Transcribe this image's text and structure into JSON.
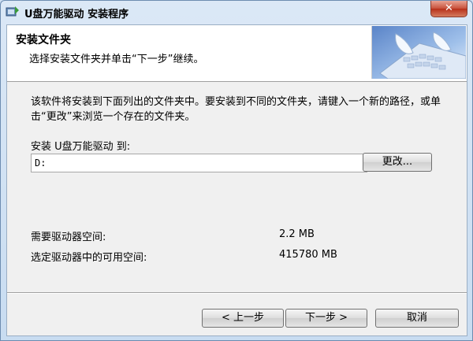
{
  "window": {
    "title": "U盘万能驱动 安装程序",
    "close_label": "✕",
    "app_icon": "installer-icon",
    "accent": "#c7503a"
  },
  "banner": {
    "title": "安装文件夹",
    "subtitle": "选择安装文件夹并单击“下一步”继续。",
    "image": "keyboard-hands-image"
  },
  "main": {
    "description": "该软件将安装到下面列出的文件夹中。要安装到不同的文件夹，请键入一个新的路径，或单击“更改”来浏览一个存在的文件夹。",
    "install_label": "安装 U盘万能驱动 到:",
    "path_value": "D:",
    "change_button": "更改...",
    "required_label": "需要驱动器空间:",
    "required_value": "2.2 MB",
    "available_label": "选定驱动器中的可用空间:",
    "available_value": "415780 MB"
  },
  "footer": {
    "back_button": "< 上一步",
    "next_button": "下一步 >",
    "cancel_button": "取消"
  }
}
